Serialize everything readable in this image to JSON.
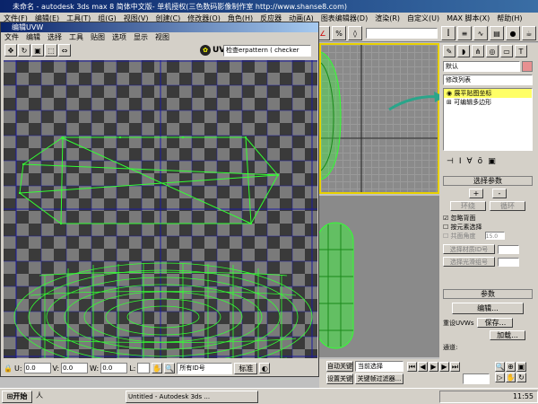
{
  "max": {
    "title": "未命名 - autodesk 3ds max 8  简体中文版- 单机授权(三色数码影像制作室  http://www.shanse8.com)",
    "menu": [
      "文件(F)",
      "编辑(E)",
      "工具(T)",
      "组(G)",
      "视图(V)",
      "创建(C)",
      "修改器(O)",
      "角色(H)",
      "反应器",
      "动画(A)",
      "图表编辑器(D)",
      "渲染(R)",
      "自定义(U)",
      "MAX 脚本(X)",
      "帮助(H)"
    ]
  },
  "uvw": {
    "title": "编辑UVW",
    "menu": [
      "文件",
      "编辑",
      "选择",
      "工具",
      "贴图",
      "选项",
      "显示",
      "视图"
    ],
    "uv_label": "UV",
    "texture_select": "检查erpattern  ( checker",
    "u_label": "U:",
    "u_value": "0.0",
    "v_label": "V:",
    "v_value": "0.0",
    "w_label": "W:",
    "w_value": "0.0",
    "l_label": "L:",
    "ids_select": "所有ID号",
    "std_label": "标准"
  },
  "cmd": {
    "name_field": "默认",
    "modifier_list": "修改列表",
    "stack": [
      "展平贴图坐标",
      "可编辑多边形"
    ],
    "select_rollout": "选择参数",
    "plus": "+",
    "minus": "-",
    "ring": "环绕",
    "loop": "循环",
    "ignore_back": "忽略背面",
    "select_by_element": "按元素选择",
    "planar_angle": "共面角度",
    "planar_value": "15.0",
    "select_mat_id": "选择材质ID号",
    "select_smooth": "选择光滑组号",
    "params_rollout": "参数",
    "edit_btn": "编辑...",
    "reset_uvw": "重设UVWs",
    "save_btn": "保存...",
    "load_btn": "加载...",
    "channel": "通道:"
  },
  "status": {
    "autokey": "自动关键",
    "current_sel": "当前选择",
    "set_key": "设置关键",
    "key_filters": "关键帧过滤器..."
  },
  "taskbar": {
    "start": "开始",
    "task": "Untitled - Autodesk 3ds ...",
    "clock": "11:55"
  },
  "colors": {
    "uv_edge": "#33ff33",
    "uv_border": "#1a1aa0",
    "stack_highlight": "#ffff66",
    "arrow": "#2aa58a"
  }
}
